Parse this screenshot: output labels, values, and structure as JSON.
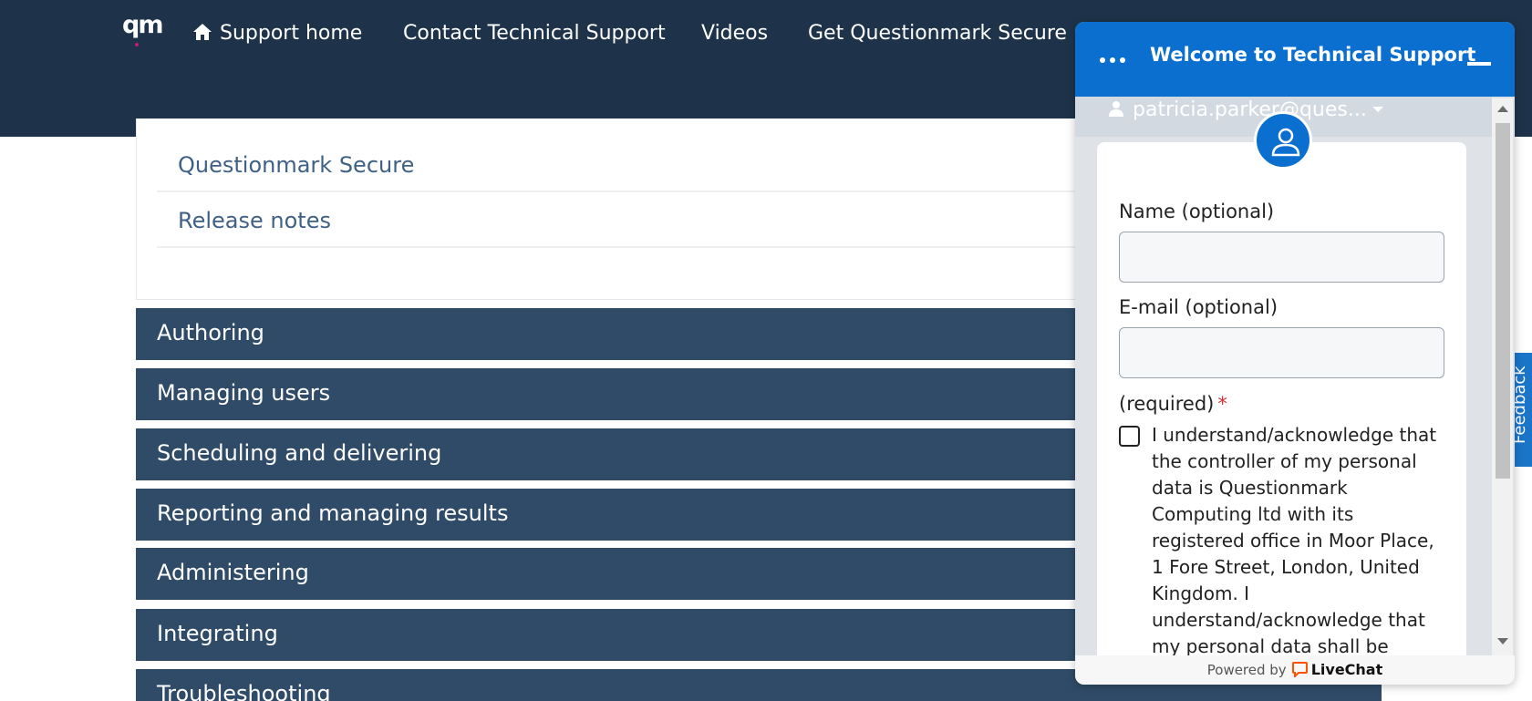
{
  "header": {
    "logo_text": "qm",
    "nav": [
      {
        "label": "Support home",
        "icon": "home-icon"
      },
      {
        "label": "Contact Technical Support"
      },
      {
        "label": "Videos"
      },
      {
        "label": "Get Questionmark Secure"
      }
    ]
  },
  "card": {
    "links": [
      "Questionmark Secure",
      "Release notes"
    ]
  },
  "sections": [
    "Authoring",
    "Managing users",
    "Scheduling and delivering",
    "Reporting and managing results",
    "Administering",
    "Integrating",
    "Troubleshooting"
  ],
  "feedback": {
    "label": "Feedback"
  },
  "chat": {
    "title": "Welcome to Technical Support",
    "user": "patricia.parker@ques...",
    "name_label": "Name (optional)",
    "email_label": "E-mail (optional)",
    "required_label": "(required)",
    "required_mark": "*",
    "consent_text": "I understand/acknowledge that the controller of my personal data is Questionmark Computing ltd with its registered office in Moor Place, 1 Fore Street, London, United Kingdom. I understand/acknowledge that my personal data shall be processed and transmitted in",
    "name_value": "",
    "email_value": "",
    "powered_by": "Powered by",
    "brand": "LiveChat"
  },
  "colors": {
    "nav_bg": "#1e3349",
    "accordion_bg": "#304b68",
    "link_text": "#3f6187",
    "chat_accent": "#0b6fd0",
    "livechat_orange": "#ff5100"
  }
}
